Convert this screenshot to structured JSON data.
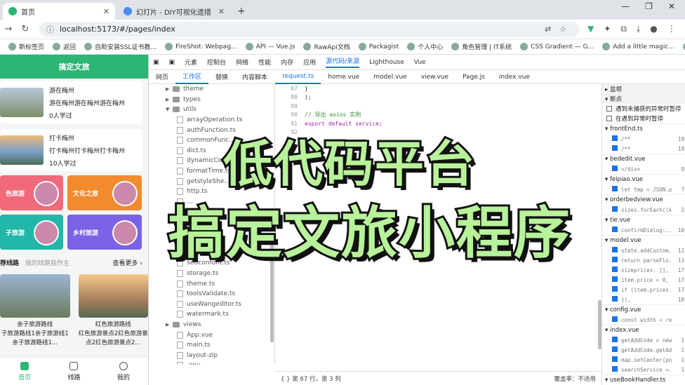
{
  "browser": {
    "tabs": [
      {
        "label": "首页",
        "active": true
      },
      {
        "label": "幻灯片 - DIY可视化遗措",
        "active": false
      }
    ],
    "new_tab": "+",
    "url": "localhost:5173/#/pages/index",
    "bookmarks": [
      "新标签页",
      "返回",
      "自助安装SSL证书教...",
      "FireShot: Webpag...",
      "API — Vue.js",
      "RawApi文档",
      "Packagist",
      "个人中心",
      "角色管理 | IT系统",
      "CSS Gradient — G...",
      "Add a little magic...",
      "所有"
    ]
  },
  "app": {
    "title": "搞定文旅",
    "cards": [
      {
        "title": "游在梅州",
        "desc": "游在梅州游在梅州游在梅州",
        "count": "0人学过"
      },
      {
        "title": "打卡梅州",
        "desc": "打卡梅州打卡梅州打卡梅州",
        "count": "10人学过"
      }
    ],
    "tiles": [
      {
        "label": "色旅游",
        "color": "#f06a7a"
      },
      {
        "label": "文化之旅",
        "color": "#f28a2e"
      },
      {
        "label": "子旅游",
        "color": "#22b7a8"
      },
      {
        "label": "乡村旅游",
        "color": "#7b62e6"
      }
    ],
    "section": {
      "title": "荐线路",
      "sub": "我的线路我作主",
      "more": "查看更多 ›"
    },
    "products": [
      {
        "title": "亲子旅游路线",
        "desc": "子旅游路线1亲子旅游线1亲子旅游路线1..."
      },
      {
        "title": "红色旅游路线",
        "desc": "红色旅游景点2红色旅游景点2红色旅游景点2..."
      }
    ],
    "tabbar": [
      {
        "label": "首页",
        "active": true
      },
      {
        "label": "线路",
        "active": false
      },
      {
        "label": "我的",
        "active": false
      }
    ]
  },
  "devtools": {
    "panels": [
      "元素",
      "控制台",
      "网络",
      "性能",
      "内存",
      "应用",
      "源代码/来源",
      "Lighthouse",
      "Vue"
    ],
    "active_panel": "源代码/来源",
    "nav_tabs": [
      "网页",
      "工作区",
      "替换",
      "内容脚本"
    ],
    "active_nav": "工作区",
    "files": [
      "request.ts",
      "home.vue",
      "model.vue",
      "view.vue",
      "Page.js",
      "index.vue"
    ],
    "tree": [
      {
        "t": "folder",
        "n": "theme"
      },
      {
        "t": "folder",
        "n": "types"
      },
      {
        "t": "folder-open",
        "n": "utils"
      },
      {
        "t": "file",
        "n": "arrayOperation.ts"
      },
      {
        "t": "file",
        "n": "authFunction.ts"
      },
      {
        "t": "file",
        "n": "commonFunc..."
      },
      {
        "t": "file",
        "n": "dict.ts"
      },
      {
        "t": "file",
        "n": "dynamicCom..."
      },
      {
        "t": "file",
        "n": "formatTime.ts"
      },
      {
        "t": "file",
        "n": "getstyleShe..."
      },
      {
        "t": "file",
        "n": "http.ts"
      },
      {
        "t": "file",
        "n": "..."
      },
      {
        "t": "file",
        "n": ""
      },
      {
        "t": "file",
        "n": ""
      },
      {
        "t": "file",
        "n": ""
      },
      {
        "t": "file",
        "n": ""
      },
      {
        "t": "file",
        "n": "request.ts"
      },
      {
        "t": "file",
        "n": "setIconfont.ts"
      },
      {
        "t": "file",
        "n": "storage.ts"
      },
      {
        "t": "file",
        "n": "theme.ts"
      },
      {
        "t": "file",
        "n": "toolsValidate.ts"
      },
      {
        "t": "file",
        "n": "useWangeditor.ts"
      },
      {
        "t": "file",
        "n": "watermark.ts"
      },
      {
        "t": "folder",
        "n": "views"
      },
      {
        "t": "file",
        "n": "App.vue"
      },
      {
        "t": "file",
        "n": "main.ts"
      },
      {
        "t": "file",
        "n": "layout-zip"
      },
      {
        "t": "file",
        "n": ".env"
      }
    ],
    "code": [
      {
        "n": "87",
        "c": "    }"
      },
      {
        "n": "88",
        "c": "  );"
      },
      {
        "n": "89",
        "c": ""
      },
      {
        "n": "90",
        "c": "  // 导出 axios 实例"
      },
      {
        "n": "91",
        "c": "  export default service;"
      },
      {
        "n": "92",
        "c": ""
      }
    ],
    "status": {
      "pos": "{ }  第 67 行，第 3 列",
      "coverage": "覆盖率：不适用"
    },
    "right": {
      "watch": "监视",
      "breakpoints": "断点",
      "checks": [
        "遇到未捕获的异常时暂停",
        "在遇到异常时暂停"
      ],
      "groups": [
        {
          "file": "frontEnd.ts",
          "lines": [
            [
              "/**",
              "19"
            ],
            [
              "/**",
              "19"
            ]
          ]
        },
        {
          "file": "bededit.vue",
          "lines": [
            [
              "</div>",
              "9"
            ]
          ]
        },
        {
          "file": "feipiao.vue",
          "lines": [
            [
              "let tmp = JSON.p...",
              "7"
            ]
          ]
        },
        {
          "file": "orderbedview.vue",
          "lines": [
            [
              "sizes.forEach((k...",
              "2"
            ]
          ]
        },
        {
          "file": "tie.vue",
          "lines": [
            [
              "confirmDialog:...",
              "10"
            ]
          ]
        },
        {
          "file": "model.vue",
          "lines": [
            [
              "state.addCustom...",
              "12"
            ],
            [
              "return parseFlo...",
              "13"
            ],
            [
              "sizeprices: [],",
              "17"
            ],
            [
              "item.price = 0,",
              "17"
            ],
            [
              "if (item.prices...",
              "17"
            ],
            [
              "}),",
              "18"
            ]
          ]
        },
        {
          "file": "config.vue",
          "lines": [
            [
              "const width = ref...",
              ""
            ]
          ]
        },
        {
          "file": "index.vue",
          "lines": [
            [
              "getAddCode = new...",
              "1"
            ],
            [
              "getAddCode.getAd...",
              "1"
            ],
            [
              "map.setCenter(po...",
              "1"
            ],
            [
              "searchService =...",
              "1"
            ]
          ]
        },
        {
          "file": "useBookHandler.ts",
          "lines": []
        }
      ]
    }
  },
  "overlay": {
    "line1": "低代码平台",
    "line2": "搞定文旅小程序"
  }
}
